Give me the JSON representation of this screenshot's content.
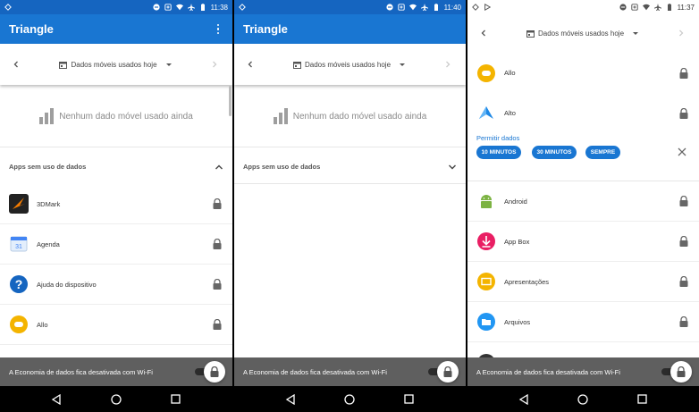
{
  "screens": [
    {
      "status": {
        "time": "11:38"
      },
      "appbar": {
        "title": "Triangle"
      },
      "date": {
        "label": "Dados móveis usados hoje"
      },
      "empty_message": "Nenhum dado móvel usado ainda",
      "section": {
        "label": "Apps sem uso de dados",
        "expanded": true
      },
      "apps": [
        {
          "name": "3DMark",
          "icon": "3dmark-icon"
        },
        {
          "name": "Agenda",
          "icon": "calendar-icon"
        },
        {
          "name": "Ajuda do dispositivo",
          "icon": "help-icon"
        },
        {
          "name": "Allo",
          "icon": "allo-icon"
        }
      ],
      "toast": {
        "message": "A Economia de dados fica desativada com Wi-Fi"
      }
    },
    {
      "status": {
        "time": "11:40"
      },
      "appbar": {
        "title": "Triangle"
      },
      "date": {
        "label": "Dados móveis usados hoje"
      },
      "empty_message": "Nenhum dado móvel usado ainda",
      "section": {
        "label": "Apps sem uso de dados",
        "expanded": false
      },
      "toast": {
        "message": "A Economia de dados fica desativada com Wi-Fi"
      }
    },
    {
      "status": {
        "time": "11:37"
      },
      "date": {
        "label": "Dados móveis usados hoje"
      },
      "apps_top": [
        {
          "name": "Allo",
          "icon": "allo-icon"
        },
        {
          "name": "Alto",
          "icon": "alto-icon"
        }
      ],
      "permit": {
        "title": "Permitir dados",
        "options": [
          "10 MINUTOS",
          "30 MINUTOS",
          "SEMPRE"
        ]
      },
      "apps_bottom": [
        {
          "name": "Android",
          "icon": "android-icon"
        },
        {
          "name": "App Box",
          "icon": "appbox-icon"
        },
        {
          "name": "Apresentações",
          "icon": "slides-icon"
        },
        {
          "name": "Arquivos",
          "icon": "files-icon"
        }
      ],
      "toast": {
        "message": "A Economia de dados fica desativada com Wi-Fi"
      }
    }
  ],
  "colors": {
    "primary": "#1976d2",
    "status_bar": "#1565c0",
    "toast": "#5f5f5f"
  }
}
